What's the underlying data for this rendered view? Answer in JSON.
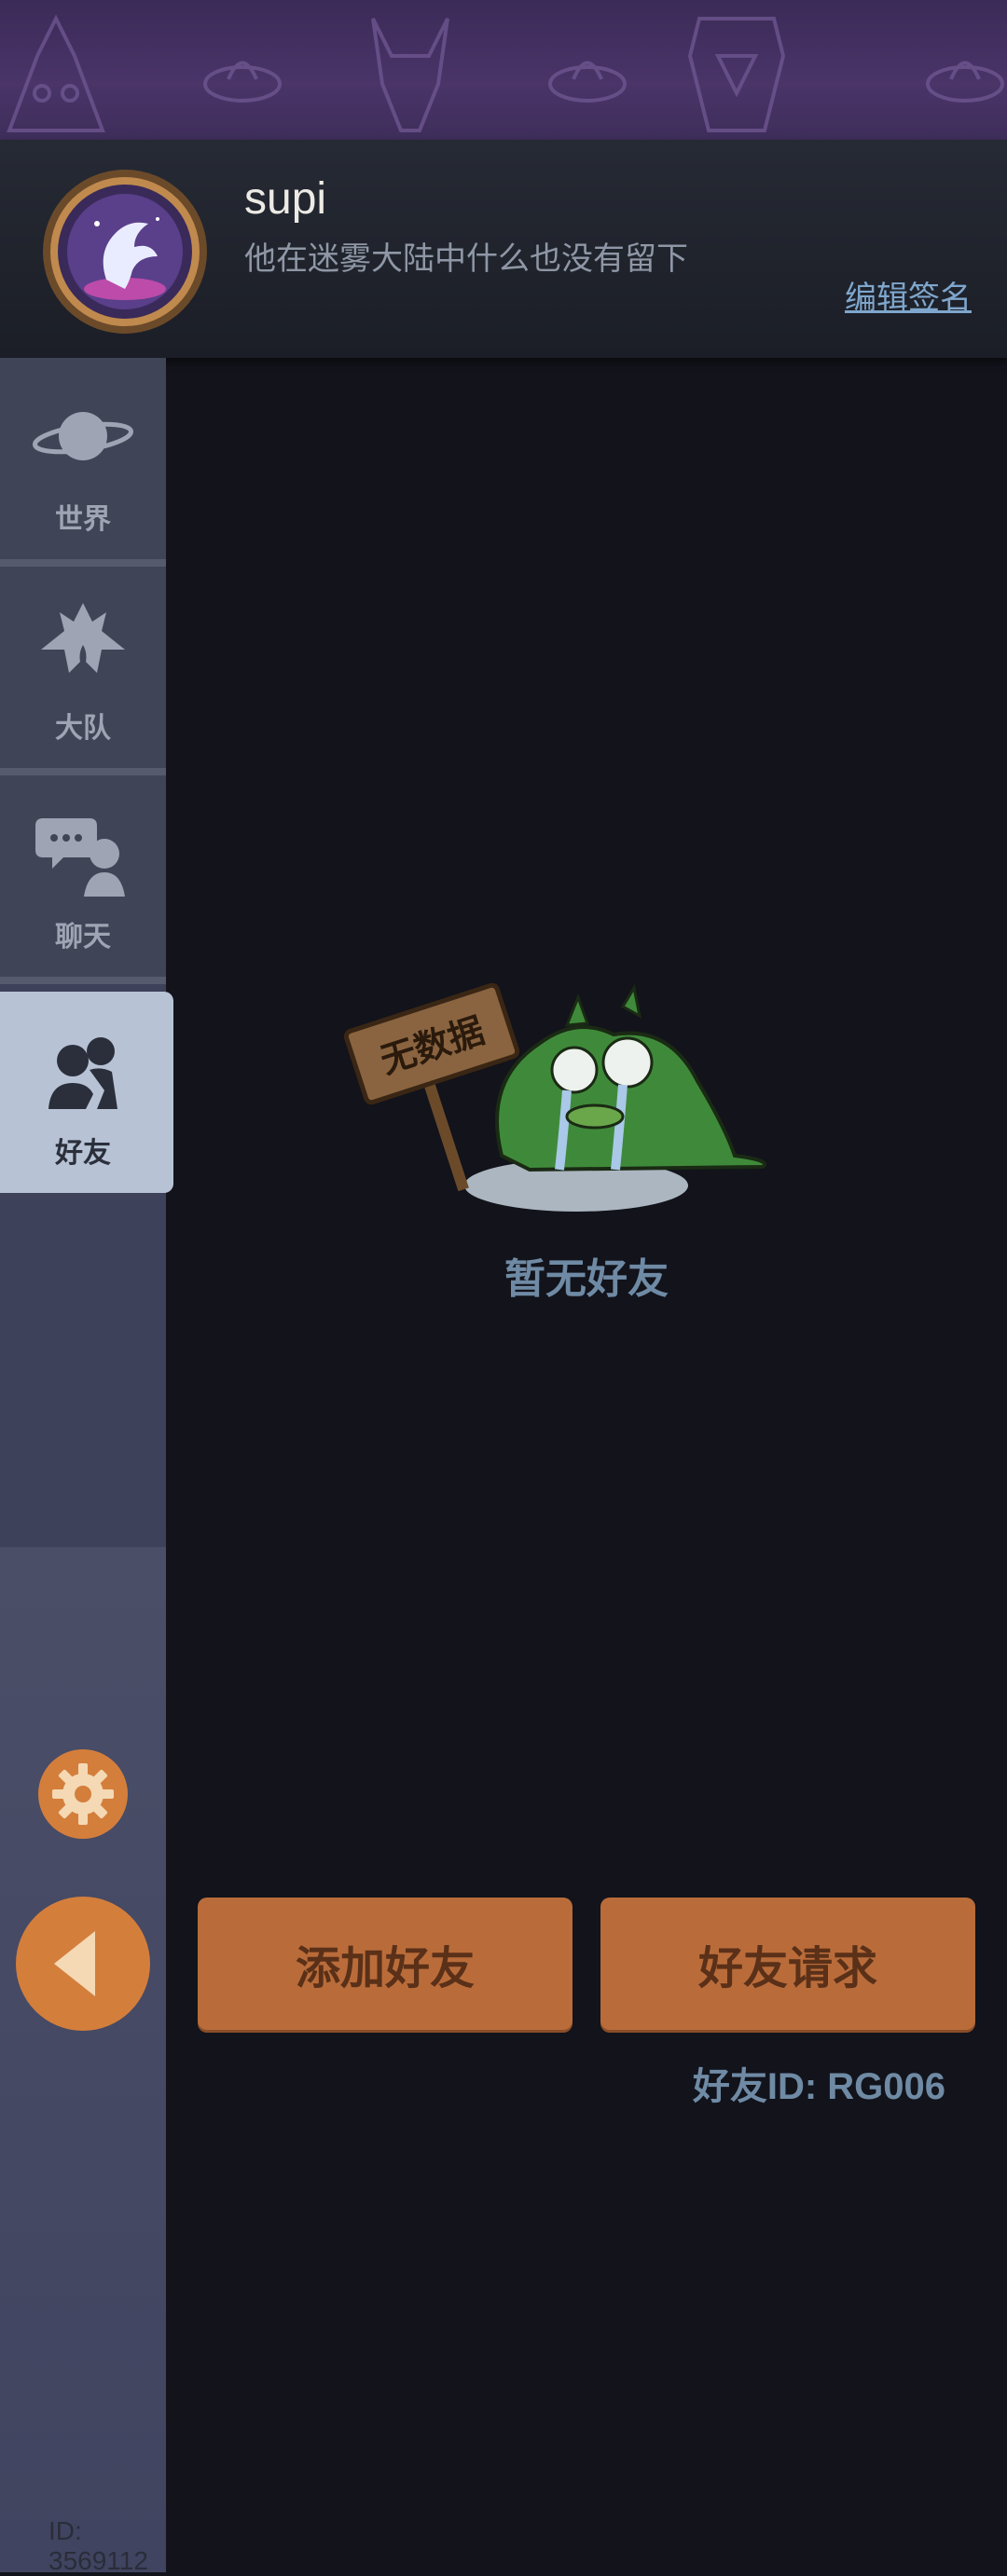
{
  "profile": {
    "username": "supi",
    "signature": "他在迷雾大陆中什么也没有留下",
    "edit_signature": "编辑签名"
  },
  "sidebar": {
    "items": [
      {
        "label": "世界",
        "icon": "planet-icon"
      },
      {
        "label": "大队",
        "icon": "guild-flame-icon"
      },
      {
        "label": "聊天",
        "icon": "chat-bubbles-icon"
      },
      {
        "label": "好友",
        "icon": "friends-icon",
        "active": true
      }
    ],
    "user_id": "ID: 3569112"
  },
  "empty_state": {
    "sign_text": "无数据",
    "message": "暂无好友"
  },
  "actions": {
    "add_friend": "添加好友",
    "friend_requests": "好友请求"
  },
  "friend_id": "好友ID: RG006",
  "colors": {
    "accent": "#b96c3a",
    "active_tab": "#b7c3d4",
    "background": "#12131b"
  }
}
